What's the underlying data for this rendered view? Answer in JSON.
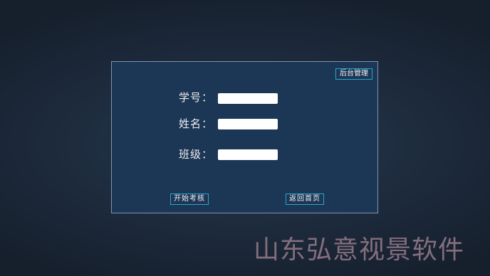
{
  "panel": {
    "admin_button": "后台管理",
    "fields": [
      {
        "label": "学号：",
        "value": ""
      },
      {
        "label": "姓名：",
        "value": ""
      },
      {
        "label": "班级：",
        "value": ""
      }
    ],
    "start_button": "开始考核",
    "back_button": "返回首页"
  },
  "watermark": "山东弘意视景软件",
  "colors": {
    "background": "#1f2d40",
    "panel": "#1c3656",
    "button_border": "#2aa6c9",
    "watermark": "#8a7282"
  }
}
